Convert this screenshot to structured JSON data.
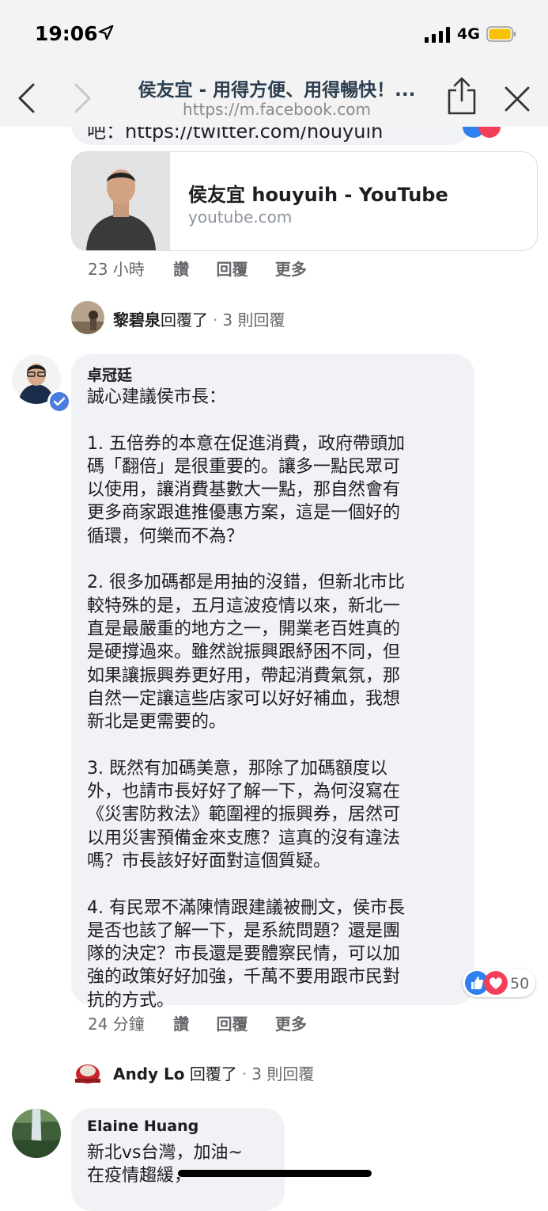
{
  "status_bar": {
    "time": "19:06",
    "network": "4G"
  },
  "browser": {
    "title": "侯友宜 - 用得方便、用得暢快！...",
    "url": "https://m.facebook.com"
  },
  "previous_comment": {
    "text_fragment": "吧：https://twitter.com/houyuih"
  },
  "link_preview": {
    "title": "侯友宜 houyuih - YouTube",
    "domain": "youtube.com"
  },
  "previous_actions": {
    "time": "23 小時",
    "like": "讚",
    "reply": "回覆",
    "more": "更多"
  },
  "reply_thread_1": {
    "name": "黎碧泉",
    "verb": "回覆了",
    "dot": "·",
    "count": "3 則回覆"
  },
  "main_comment": {
    "author": "卓冠廷",
    "verified": true,
    "body": "誠心建議侯市長：\n\n1. 五倍券的本意在促進消費，政府帶頭加\n碼「翻倍」是很重要的。讓多一點民眾可\n以使用，讓消費基數大一點，那自然會有\n更多商家跟進推優惠方案，這是一個好的\n循環，何樂而不為？\n\n2. 很多加碼都是用抽的沒錯，但新北市比\n較特殊的是，五月這波疫情以來，新北一\n直是最嚴重的地方之一，開業老百姓真的\n是硬撐過來。雖然說振興跟紓困不同，但\n如果讓振興券更好用，帶起消費氣氛，那\n自然一定讓這些店家可以好好補血，我想\n新北是更需要的。\n\n3. 既然有加碼美意，那除了加碼額度以\n外，也請市長好好了解一下，為何沒寫在\n《災害防救法》範圍裡的振興券，居然可\n以用災害預備金來支應？這真的沒有違法\n嗎？市長該好好面對這個質疑。\n\n4. 有民眾不滿陳情跟建議被刪文，侯市長\n是否也該了解一下，是系統問題？還是團\n隊的決定？市長還是要體察民情，可以加\n強的政策好好加強，千萬不要用跟市民對\n抗的方式。",
    "reaction_count": "50"
  },
  "main_actions": {
    "time": "24 分鐘",
    "like": "讚",
    "reply": "回覆",
    "more": "更多"
  },
  "reply_thread_2": {
    "name": "Andy Lo",
    "verb": "回覆了",
    "dot": "·",
    "count": "3 則回覆"
  },
  "next_comment": {
    "author": "Elaine Huang",
    "body": "新北vs台灣，加油~\n在疫情趨緩，"
  },
  "colors": {
    "bubble": "#f0f2f5",
    "like_blue": "#2e7ff0",
    "love_red": "#f33e58",
    "verified_blue": "#4a7cdd"
  }
}
